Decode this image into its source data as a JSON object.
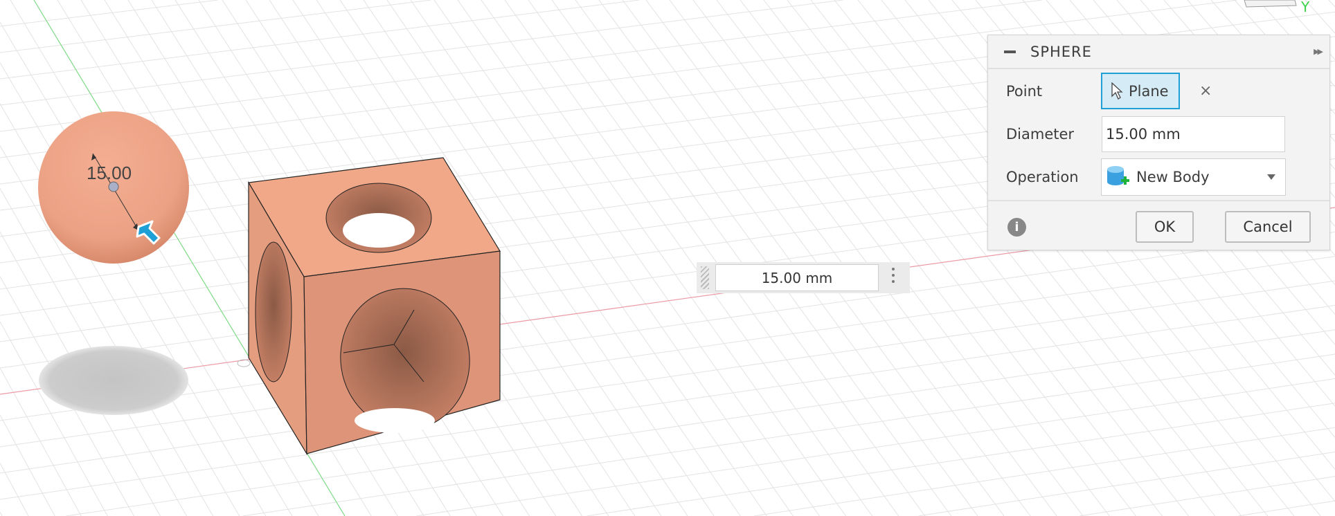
{
  "dialog": {
    "title": "SPHERE",
    "point_label": "Point",
    "point_selection": "Plane",
    "diameter_label": "Diameter",
    "diameter_value": "15.00 mm",
    "operation_label": "Operation",
    "operation_value": "New Body",
    "ok_label": "OK",
    "cancel_label": "Cancel",
    "clear_glyph": "×"
  },
  "viewport": {
    "sphere_dimension_label": "15.00",
    "dimension_input_value": "15.00 mm",
    "axis_label": "Y"
  },
  "colors": {
    "body": "#e9967a",
    "accent": "#1e9fd6",
    "x_axis": "#e06070",
    "y_axis": "#3bd24a"
  }
}
